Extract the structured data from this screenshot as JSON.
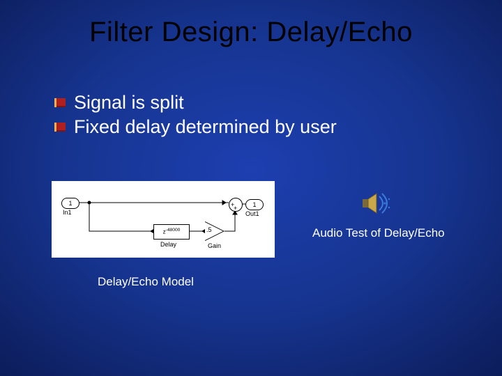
{
  "title": "Filter Design: Delay/Echo",
  "bullets": [
    "Signal is split",
    "Fixed delay determined by user"
  ],
  "diagram": {
    "in_port": "1",
    "in_label": "In1",
    "out_port": "1",
    "out_label": "Out1",
    "delay_value": "-48000",
    "delay_label": "Delay",
    "gain_value": ".5",
    "gain_label": "Gain"
  },
  "captions": {
    "model": "Delay/Echo Model",
    "audio": "Audio Test of Delay/Echo"
  }
}
